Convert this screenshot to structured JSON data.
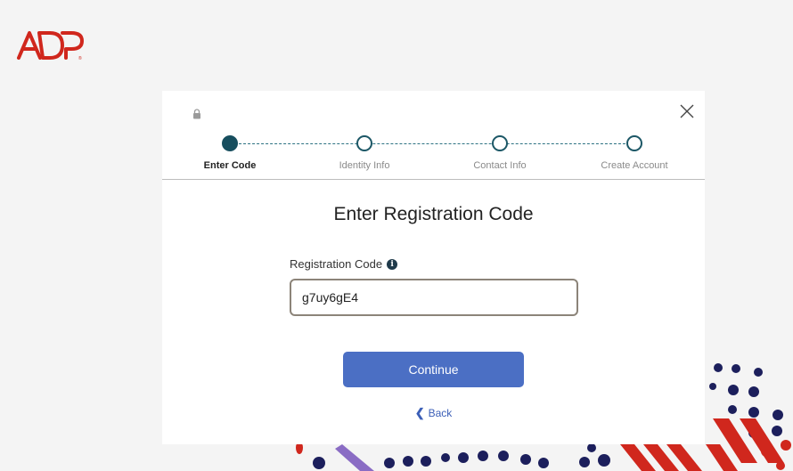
{
  "brand": {
    "logo_text": "ADP",
    "logo_color": "#d0271d"
  },
  "modal": {
    "lock_icon": "lock-icon",
    "close_icon": "close-icon",
    "title": "Enter Registration Code",
    "field_label": "Registration Code",
    "info_icon": "info-icon",
    "info_glyph": "i",
    "code_value": "g7uy6gE4",
    "continue_label": "Continue",
    "back_glyph": "❮",
    "back_label": "Back"
  },
  "stepper": {
    "active_index": 0,
    "steps": [
      {
        "label": "Enter Code"
      },
      {
        "label": "Identity Info"
      },
      {
        "label": "Contact Info"
      },
      {
        "label": "Create Account"
      }
    ]
  },
  "colors": {
    "accent": "#4b6fc4",
    "step_active": "#174e5e",
    "background": "#f4f4f4",
    "deco_navy": "#1c1f5c",
    "deco_red": "#d0271d",
    "deco_purple": "#8a6cc4"
  }
}
